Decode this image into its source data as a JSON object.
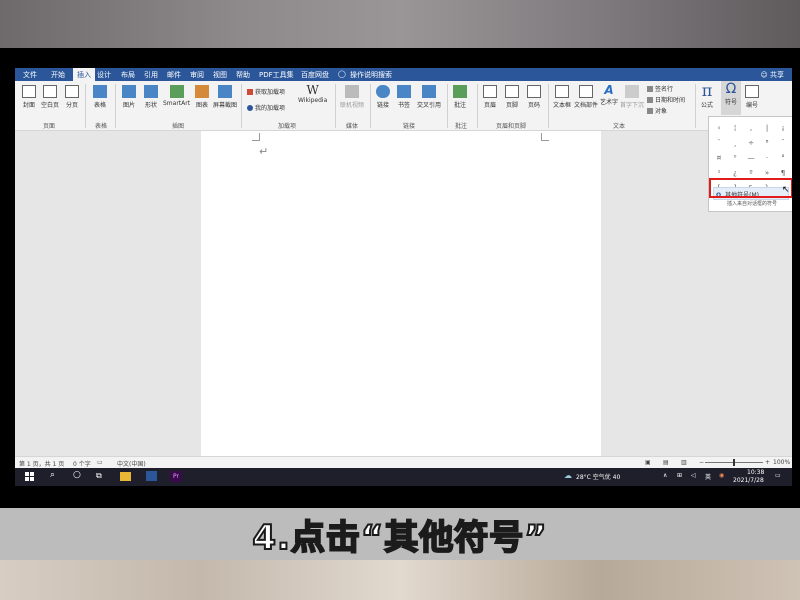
{
  "caption": "4.点击“其他符号”",
  "menubar": {
    "tabs": [
      "文件",
      "开始",
      "插入",
      "设计",
      "布局",
      "引用",
      "邮件",
      "审阅",
      "视图",
      "帮助",
      "PDF工具集",
      "百度网盘"
    ],
    "active_tab": "插入",
    "search": "操作说明搜索",
    "share": "共享"
  },
  "ribbon": {
    "pages": [
      "封面",
      "空白页",
      "分页"
    ],
    "pages_group": "页面",
    "table": "表格",
    "table_group": "表格",
    "illustrations": [
      "图片",
      "形状",
      "SmartArt",
      "图表",
      "屏幕截图"
    ],
    "illustrations_group": "插图",
    "addins": [
      "获取加载项",
      "我的加载项"
    ],
    "wikipedia": "Wikipedia",
    "addins_group": "加载项",
    "online_video": "联机视频",
    "media_group": "媒体",
    "links": [
      "链接",
      "书签",
      "交叉引用"
    ],
    "links_group": "链接",
    "comment": "批注",
    "comment_group": "批注",
    "header_footer": [
      "页眉",
      "页脚",
      "页码"
    ],
    "header_footer_group": "页眉和页脚",
    "text": [
      "文本框",
      "文档部件",
      "艺术字",
      "首字下沉"
    ],
    "text_small": [
      "签名行",
      "日期和时间",
      "对象"
    ],
    "text_group": "文本",
    "equation": "公式",
    "symbol": "符号",
    "number": "编号"
  },
  "symbol_dropdown": {
    "symbols": [
      "‹",
      "¦",
      "‚",
      "|",
      "¡",
      "¨",
      "¸",
      "÷",
      "⁸",
      "¯",
      "¤",
      "⁰",
      "—",
      "·",
      "°",
      "¹",
      "¿",
      "º",
      "»",
      "¶",
      "[",
      "]",
      "&",
      "}"
    ],
    "more_symbols": "其他符号(M)...",
    "tooltip": "插入来自对话框的符号"
  },
  "statusbar": {
    "page": "第 1 页，共 1 页",
    "words": "0 个字",
    "language": "中文(中国)",
    "zoom": "100%"
  },
  "taskbar": {
    "weather": "28°C 空气优 40",
    "time": "10:38",
    "date": "2021/7/28"
  }
}
